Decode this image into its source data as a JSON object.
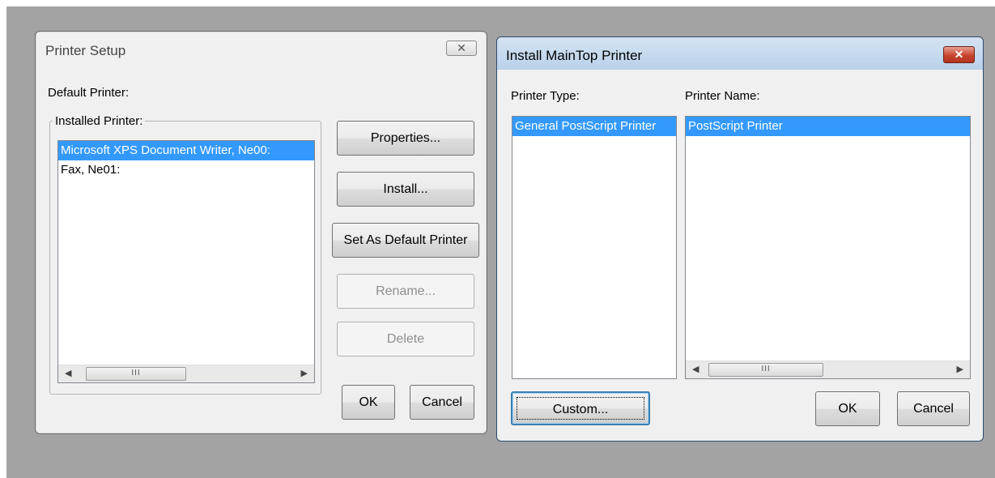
{
  "printer_setup": {
    "title": "Printer Setup",
    "close_glyph": "✕",
    "default_printer_label": "Default Printer:",
    "installed_group_label": "Installed Printer:",
    "installed_printers": [
      "Microsoft XPS Document Writer, Ne00:",
      "Fax, Ne01:"
    ],
    "selected_index": 0,
    "scroll_thumb": "III",
    "buttons": {
      "properties": "Properties...",
      "install": "Install...",
      "set_default": "Set As Default Printer",
      "rename": "Rename...",
      "delete": "Delete",
      "ok": "OK",
      "cancel": "Cancel"
    },
    "disabled_buttons": [
      "rename",
      "delete"
    ]
  },
  "install_maintop": {
    "title": "Install MainTop Printer",
    "close_glyph": "✕",
    "printer_type_label": "Printer Type:",
    "printer_name_label": "Printer Name:",
    "printer_types": [
      "General PostScript Printer"
    ],
    "printer_names": [
      "PostScript Printer"
    ],
    "scroll_thumb": "III",
    "buttons": {
      "custom": "Custom...",
      "ok": "OK",
      "cancel": "Cancel"
    }
  },
  "colors": {
    "selection": "#3399ff",
    "close_button": "#c7452e"
  }
}
